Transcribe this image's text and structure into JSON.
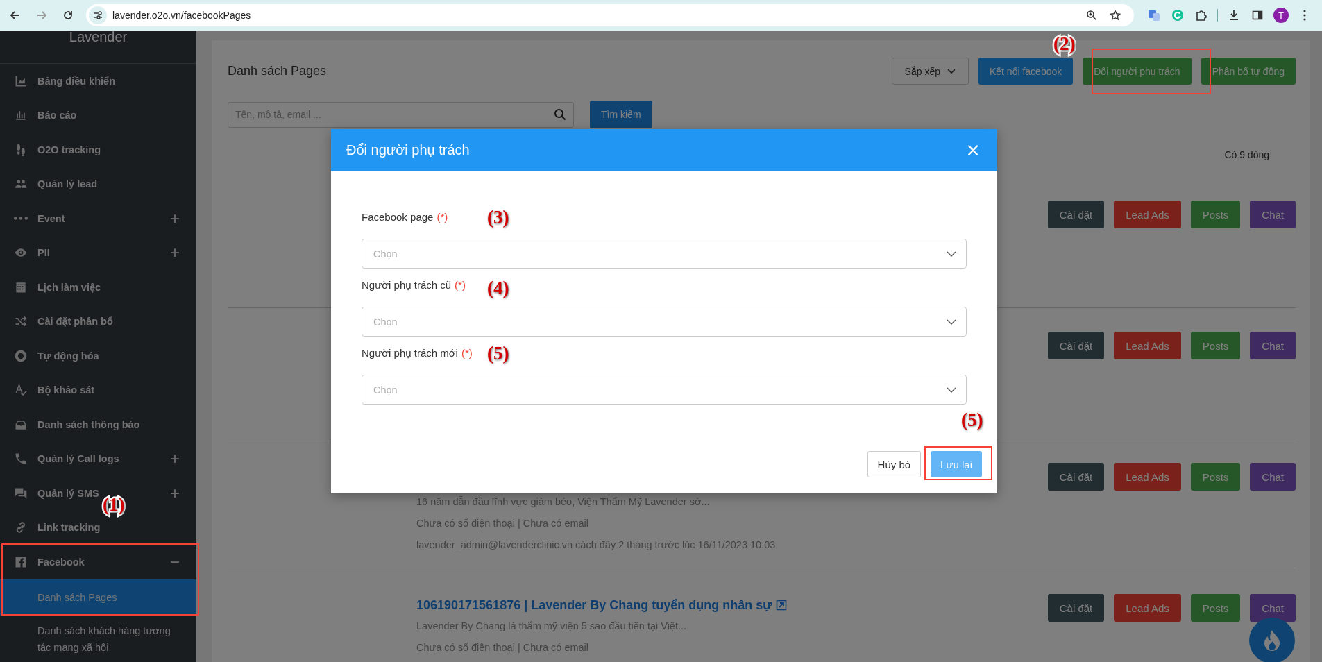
{
  "browser": {
    "url": "lavender.o2o.vn/facebookPages",
    "profile_initial": "T"
  },
  "sidebar": {
    "brand": "Lavender",
    "items": [
      {
        "label": "Bảng điều khiển",
        "selected": false
      },
      {
        "label": "Báo cáo",
        "selected": false
      },
      {
        "label": "O2O tracking",
        "selected": false
      },
      {
        "label": "Quản lý lead",
        "selected": false
      },
      {
        "label": "Event",
        "selected": false,
        "expanded": false,
        "toggle": "+"
      },
      {
        "label": "PII",
        "selected": false,
        "expanded": false,
        "toggle": "+"
      },
      {
        "label": "Lịch làm việc",
        "selected": false
      },
      {
        "label": "Cài đặt phân bổ",
        "selected": false
      },
      {
        "label": "Tự động hóa",
        "selected": false
      },
      {
        "label": "Bộ khảo sát",
        "selected": false
      },
      {
        "label": "Danh sách thông báo",
        "selected": false
      },
      {
        "label": "Quản lý Call logs",
        "selected": false,
        "expanded": false,
        "toggle": "+"
      },
      {
        "label": "Quản lý SMS",
        "selected": false,
        "expanded": false,
        "toggle": "+"
      },
      {
        "label": "Link tracking",
        "selected": false
      },
      {
        "label": "Facebook",
        "selected": false,
        "expanded": true,
        "toggle": "−",
        "children": [
          {
            "label": "Danh sách Pages",
            "selected": true
          },
          {
            "label": "Danh sách khách hàng tương tác mạng xã hội",
            "selected": false
          }
        ]
      }
    ]
  },
  "page": {
    "title": "Danh sách Pages",
    "sort_button": "Sắp xếp",
    "actions": [
      {
        "label": "Kết nối facebook",
        "kind": "blue"
      },
      {
        "label": "Đổi người phụ trách",
        "kind": "green"
      },
      {
        "label": "Phân bổ tự động",
        "kind": "green"
      }
    ],
    "search": {
      "placeholder": "Tên, mô tả, email ...",
      "button": "Tìm kiếm"
    },
    "count": "Có 9 dòng",
    "rows": [
      {
        "buttons": [
          {
            "label": "Cài đặt",
            "kind": "settings"
          },
          {
            "label": "Lead Ads",
            "kind": "lead"
          },
          {
            "label": "Posts",
            "kind": "posts"
          },
          {
            "label": "Chat",
            "kind": "chat"
          }
        ]
      },
      {
        "buttons": [
          {
            "label": "Cài đặt",
            "kind": "settings"
          },
          {
            "label": "Lead Ads",
            "kind": "lead"
          },
          {
            "label": "Posts",
            "kind": "posts"
          },
          {
            "label": "Chat",
            "kind": "chat"
          }
        ]
      },
      {
        "description": "16 năm dẫn đầu lĩnh vực giảm béo, Viện Thẩm Mỹ Lavender sở...",
        "contact": "Chưa có số điện thoại | Chưa có email",
        "updated": "lavender_admin@lavenderclinic.vn cách đây 2 tháng trước lúc 16/11/2023 10:03",
        "buttons": [
          {
            "label": "Cài đặt",
            "kind": "settings"
          },
          {
            "label": "Lead Ads",
            "kind": "lead"
          },
          {
            "label": "Posts",
            "kind": "posts"
          },
          {
            "label": "Chat",
            "kind": "chat"
          }
        ]
      },
      {
        "title": "106190171561876 | Lavender By Chang tuyển dụng nhân sự",
        "description": "Lavender By Chang là thẩm mỹ viện 5 sao đầu tiên tại Việt...",
        "contact": "Chưa có số điện thoại | Chưa có email",
        "buttons": [
          {
            "label": "Cài đặt",
            "kind": "settings"
          },
          {
            "label": "Lead Ads",
            "kind": "lead"
          },
          {
            "label": "Posts",
            "kind": "posts"
          },
          {
            "label": "Chat",
            "kind": "chat"
          }
        ]
      }
    ]
  },
  "modal": {
    "title": "Đổi người phụ trách",
    "close": "×",
    "fields": [
      {
        "label": "Facebook page",
        "required_mark": "(*)",
        "placeholder": "Chọn"
      },
      {
        "label": "Người phụ trách cũ",
        "required_mark": "(*)",
        "placeholder": "Chọn"
      },
      {
        "label": "Người phụ trách mới",
        "required_mark": "(*)",
        "placeholder": "Chọn"
      }
    ],
    "cancel": "Hủy bỏ",
    "save": "Lưu lại"
  },
  "annotations": {
    "labels": [
      {
        "text": "(1)"
      },
      {
        "text": "(2)"
      },
      {
        "text": "(3)"
      },
      {
        "text": "(4)"
      },
      {
        "text": "(5)"
      },
      {
        "text": "(5)"
      }
    ],
    "frames": [
      {
        "kind": "highlight"
      },
      {
        "kind": "highlight"
      },
      {
        "kind": "highlight"
      }
    ]
  }
}
